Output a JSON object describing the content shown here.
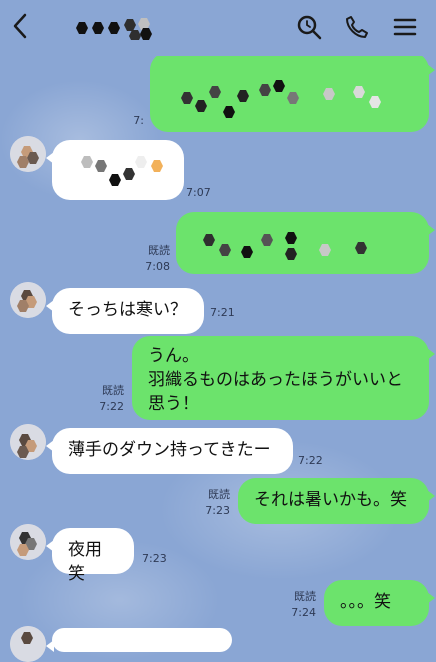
{
  "header": {
    "back_icon": "chevron-left-icon",
    "title_icons": [
      "search-icon",
      "phone-icon",
      "menu-icon"
    ]
  },
  "messages": {
    "m1": {
      "direction": "outgoing",
      "text": "",
      "time": "7:"
    },
    "m2": {
      "direction": "incoming",
      "text": "",
      "time": "7:07"
    },
    "m3": {
      "direction": "outgoing",
      "text": "",
      "read_label": "既読",
      "time": "7:08"
    },
    "m4": {
      "direction": "incoming",
      "text": "そっちは寒い？",
      "time": "7:21"
    },
    "m5": {
      "direction": "outgoing",
      "text": "うん。\n羽織るものはあったほうがいいと思う！",
      "read_label": "既読",
      "time": "7:22"
    },
    "m6": {
      "direction": "incoming",
      "text": "薄手のダウン持ってきたー",
      "time": "7:22"
    },
    "m7": {
      "direction": "outgoing",
      "text": "それは暑いかも。笑",
      "read_label": "既読",
      "time": "7:23"
    },
    "m8": {
      "direction": "incoming",
      "text": "夜用笑",
      "time": "7:23"
    },
    "m9": {
      "direction": "outgoing",
      "text": "。。。笑",
      "read_label": "既読",
      "time": "7:24"
    }
  },
  "colors": {
    "background": "#8aa6d4",
    "outgoing_bubble": "#6ce36c",
    "incoming_bubble": "#ffffff",
    "meta_text": "#2e3a55"
  }
}
